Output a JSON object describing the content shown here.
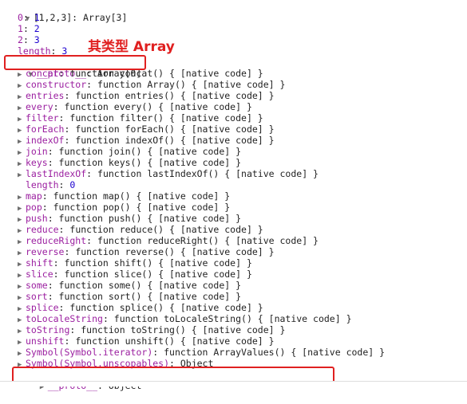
{
  "header": "[1,2,3]: Array[3]",
  "items": [
    {
      "key": "0",
      "value": "1"
    },
    {
      "key": "1",
      "value": "2"
    },
    {
      "key": "2",
      "value": "3"
    },
    {
      "key": "length",
      "value": "3"
    }
  ],
  "annotation": "其类型 Array",
  "proto_row": {
    "key": "__proto__",
    "value": ": Array[0]"
  },
  "methods": [
    {
      "key": "concat",
      "value": ": function concat() { [native code] }"
    },
    {
      "key": "constructor",
      "value": ": function Array() { [native code] }"
    },
    {
      "key": "entries",
      "value": ": function entries() { [native code] }"
    },
    {
      "key": "every",
      "value": ": function every() { [native code] }"
    },
    {
      "key": "filter",
      "value": ": function filter() { [native code] }"
    },
    {
      "key": "forEach",
      "value": ": function forEach() { [native code] }"
    },
    {
      "key": "indexOf",
      "value": ": function indexOf() { [native code] }"
    },
    {
      "key": "join",
      "value": ": function join() { [native code] }"
    },
    {
      "key": "keys",
      "value": ": function keys() { [native code] }"
    },
    {
      "key": "lastIndexOf",
      "value": ": function lastIndexOf() { [native code] }"
    },
    {
      "key": "length",
      "value": "0",
      "plain": true
    },
    {
      "key": "map",
      "value": ": function map() { [native code] }"
    },
    {
      "key": "pop",
      "value": ": function pop() { [native code] }"
    },
    {
      "key": "push",
      "value": ": function push() { [native code] }"
    },
    {
      "key": "reduce",
      "value": ": function reduce() { [native code] }"
    },
    {
      "key": "reduceRight",
      "value": ": function reduceRight() { [native code] }"
    },
    {
      "key": "reverse",
      "value": ": function reverse() { [native code] }"
    },
    {
      "key": "shift",
      "value": ": function shift() { [native code] }"
    },
    {
      "key": "slice",
      "value": ": function slice() { [native code] }"
    },
    {
      "key": "some",
      "value": ": function some() { [native code] }"
    },
    {
      "key": "sort",
      "value": ": function sort() { [native code] }"
    },
    {
      "key": "splice",
      "value": ": function splice() { [native code] }"
    },
    {
      "key": "toLocaleString",
      "value": ": function toLocaleString() { [native code] }"
    },
    {
      "key": "toString",
      "value": ": function toString() { [native code] }"
    },
    {
      "key": "unshift",
      "value": ": function unshift() { [native code] }"
    },
    {
      "key": "Symbol(Symbol.iterator)",
      "value": ": function ArrayValues() { [native code] }"
    },
    {
      "key": "Symbol(Symbol.unscopables)",
      "value": ": Object"
    }
  ],
  "proto_object": {
    "key": "__proto__",
    "value": ": Object"
  },
  "colors": {
    "key": "#9b1fa0",
    "number": "#1c00cf",
    "annotation": "#e02020"
  }
}
